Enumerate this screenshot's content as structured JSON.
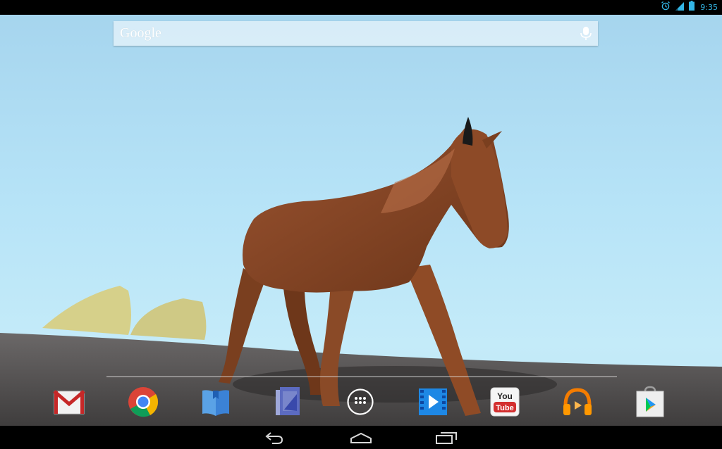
{
  "status_bar": {
    "time": "9:35",
    "icons": [
      "alarm-icon",
      "signal-icon",
      "battery-icon"
    ],
    "accent_color": "#33b5e5"
  },
  "search": {
    "logo_text": "Google",
    "icon": "mic-icon"
  },
  "dock": {
    "apps": [
      {
        "name": "gmail",
        "icon": "gmail-icon"
      },
      {
        "name": "chrome",
        "icon": "chrome-icon"
      },
      {
        "name": "play-books",
        "icon": "books-icon"
      },
      {
        "name": "play-magazines",
        "icon": "magazines-icon"
      },
      {
        "name": "all-apps",
        "icon": "app-drawer-icon"
      },
      {
        "name": "play-movies",
        "icon": "movies-icon"
      },
      {
        "name": "youtube",
        "icon": "youtube-icon",
        "label": "You Tube"
      },
      {
        "name": "play-music",
        "icon": "headphones-icon"
      },
      {
        "name": "play-store",
        "icon": "play-store-icon"
      }
    ]
  },
  "wallpaper": {
    "subject": "horse-image",
    "sky_color": "#b6e3f7",
    "ground_color": "#4a4747"
  },
  "navigation": {
    "buttons": [
      "back-icon",
      "home-icon",
      "recent-apps-icon"
    ]
  }
}
